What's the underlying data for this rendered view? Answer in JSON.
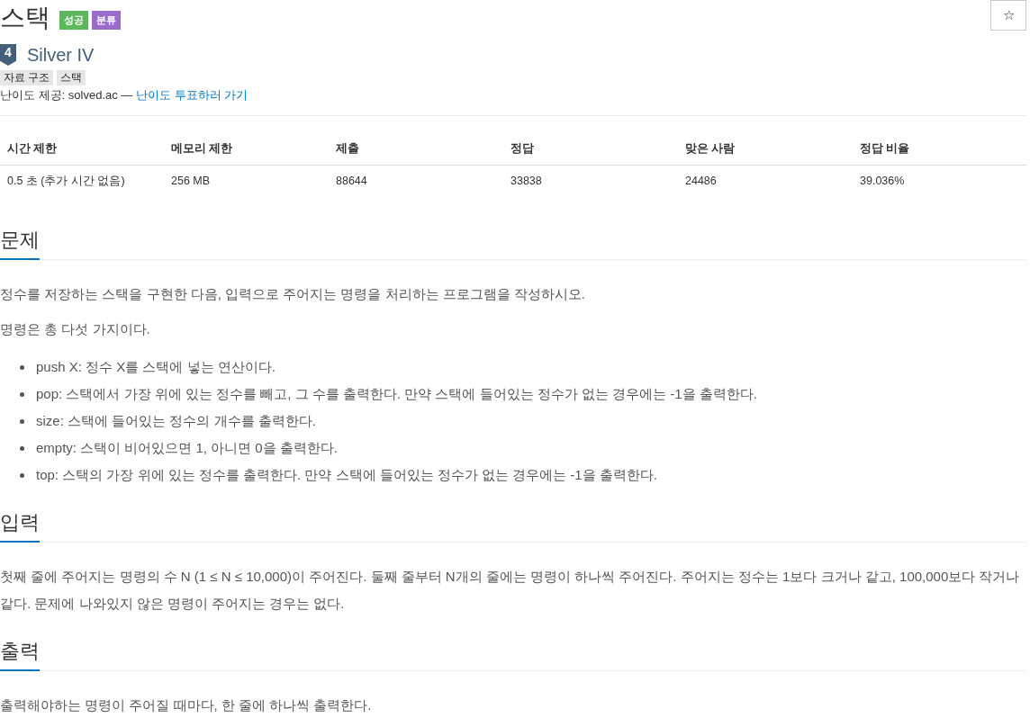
{
  "problem": {
    "title": "스택",
    "badges": [
      {
        "label": "성공",
        "color": "#5cb85c"
      },
      {
        "label": "분류",
        "color": "#9b6bcc"
      }
    ],
    "star_button": "☆"
  },
  "tier": {
    "icon_text": "4",
    "name": "Silver IV"
  },
  "tags": [
    "자료 구조",
    "스택"
  ],
  "difficulty_credit": {
    "text": "난이도 제공: solved.ac — ",
    "link": "난이도 투표하러 가기"
  },
  "info_table": {
    "columns": [
      "시간 제한",
      "메모리 제한",
      "제출",
      "정답",
      "맞은 사람",
      "정답 비율"
    ],
    "rows": [
      [
        "0.5 초 (추가 시간 없음)",
        "256 MB",
        "88644",
        "33838",
        "24486",
        "39.036%"
      ]
    ]
  },
  "sections": [
    {
      "heading": "문제",
      "blocks": [
        {
          "kind": "paragraph",
          "text": "정수를 저장하는 스택을 구현한 다음, 입력으로 주어지는 명령을 처리하는 프로그램을 작성하시오."
        },
        {
          "kind": "paragraph",
          "text": "명령은 총 다섯 가지이다."
        },
        {
          "kind": "list",
          "items": [
            "push X: 정수 X를 스택에 넣는 연산이다.",
            "pop: 스택에서 가장 위에 있는 정수를 빼고, 그 수를 출력한다. 만약 스택에 들어있는 정수가 없는 경우에는 -1을 출력한다.",
            "size: 스택에 들어있는 정수의 개수를 출력한다.",
            "empty: 스택이 비어있으면 1, 아니면 0을 출력한다.",
            "top: 스택의 가장 위에 있는 정수를 출력한다. 만약 스택에 들어있는 정수가 없는 경우에는 -1을 출력한다."
          ]
        }
      ]
    },
    {
      "heading": "입력",
      "blocks": [
        {
          "kind": "paragraph",
          "text": "첫째 줄에 주어지는 명령의 수 N (1 ≤ N ≤ 10,000)이 주어진다. 둘째 줄부터 N개의 줄에는 명령이 하나씩 주어진다. 주어지는 정수는 1보다 크거나 같고, 100,000보다 작거나 같다. 문제에 나와있지 않은 명령이 주어지는 경우는 없다."
        }
      ]
    },
    {
      "heading": "출력",
      "blocks": [
        {
          "kind": "paragraph",
          "text": "출력해야하는 명령이 주어질 때마다, 한 줄에 하나씩 출력한다."
        }
      ]
    }
  ]
}
